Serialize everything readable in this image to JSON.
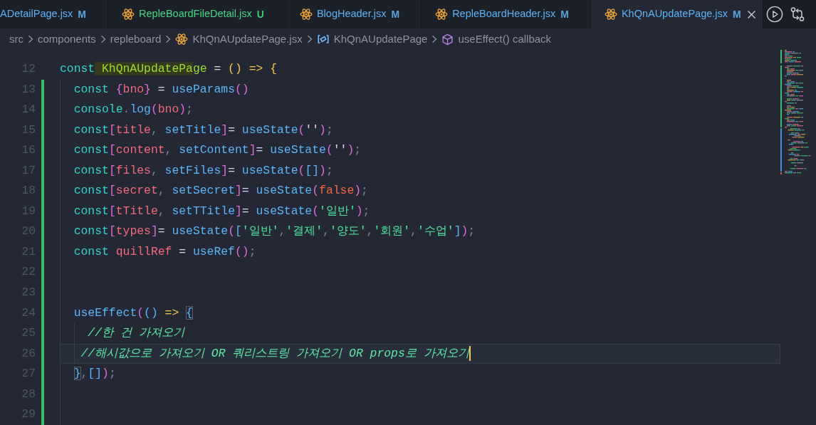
{
  "tabs": [
    {
      "label": "ADetailPage.jsx",
      "status": "M",
      "kind": "modified",
      "cut_off": true,
      "selected": false
    },
    {
      "label": "RepleBoardFileDetail.jsx",
      "status": "U",
      "kind": "untracked",
      "cut_off": false,
      "selected": false
    },
    {
      "label": "BlogHeader.jsx",
      "status": "M",
      "kind": "modified",
      "cut_off": false,
      "selected": false
    },
    {
      "label": "RepleBoardHeader.jsx",
      "status": "M",
      "kind": "modified",
      "cut_off": false,
      "selected": false
    },
    {
      "label": "KhQnAUpdatePage.jsx",
      "status": "M",
      "kind": "modified",
      "cut_off": false,
      "selected": true
    }
  ],
  "breadcrumb": [
    {
      "label": "src",
      "kind": "folder"
    },
    {
      "label": "components",
      "kind": "folder"
    },
    {
      "label": "repleboard",
      "kind": "folder"
    },
    {
      "label": "KhQnAUpdatePage.jsx",
      "kind": "file"
    },
    {
      "label": "KhQnAUpdatePage",
      "kind": "constant"
    },
    {
      "label": "useEffect() callback",
      "kind": "method"
    }
  ],
  "editor": {
    "lines": [
      {
        "number": "12",
        "added": false,
        "current": false,
        "tokens": [
          {
            "text": "const",
            "kind": "keyword"
          },
          {
            "text": " KhQnAUpdatePa",
            "kind": "definition_match"
          },
          {
            "text": "ge",
            "kind": "definition"
          },
          {
            "text": " = ",
            "kind": "operator"
          },
          {
            "text": "()",
            "kind": "bracket_1"
          },
          {
            "text": " => ",
            "kind": "arrow"
          },
          {
            "text": "{",
            "kind": "bracket_1"
          }
        ]
      },
      {
        "number": "13",
        "added": true,
        "current": false,
        "tokens": [
          {
            "text": "  const ",
            "kind": "keyword"
          },
          {
            "text": "{",
            "kind": "bracket_2"
          },
          {
            "text": "bno",
            "kind": "variable"
          },
          {
            "text": "}",
            "kind": "bracket_2"
          },
          {
            "text": " = ",
            "kind": "operator"
          },
          {
            "text": "useParams",
            "kind": "function"
          },
          {
            "text": "()",
            "kind": "bracket_2"
          }
        ]
      },
      {
        "number": "14",
        "added": true,
        "current": false,
        "tokens": [
          {
            "text": "  console",
            "kind": "keyword"
          },
          {
            "text": ".",
            "kind": "punctuation"
          },
          {
            "text": "log",
            "kind": "function"
          },
          {
            "text": "(",
            "kind": "bracket_2"
          },
          {
            "text": "bno",
            "kind": "variable"
          },
          {
            "text": ")",
            "kind": "bracket_2"
          },
          {
            "text": ";",
            "kind": "punctuation"
          }
        ]
      },
      {
        "number": "15",
        "added": true,
        "current": false,
        "tokens": [
          {
            "text": "  const",
            "kind": "keyword"
          },
          {
            "text": "[",
            "kind": "bracket_2"
          },
          {
            "text": "title",
            "kind": "variable"
          },
          {
            "text": ", ",
            "kind": "punctuation"
          },
          {
            "text": "setTitle",
            "kind": "function"
          },
          {
            "text": "]",
            "kind": "bracket_2"
          },
          {
            "text": "= ",
            "kind": "operator"
          },
          {
            "text": "useState",
            "kind": "function"
          },
          {
            "text": "(",
            "kind": "bracket_2"
          },
          {
            "text": "''",
            "kind": "quote"
          },
          {
            "text": ")",
            "kind": "bracket_2"
          },
          {
            "text": ";",
            "kind": "punctuation"
          }
        ]
      },
      {
        "number": "16",
        "added": true,
        "current": false,
        "tokens": [
          {
            "text": "  const",
            "kind": "keyword"
          },
          {
            "text": "[",
            "kind": "bracket_2"
          },
          {
            "text": "content",
            "kind": "variable"
          },
          {
            "text": ", ",
            "kind": "punctuation"
          },
          {
            "text": "setContent",
            "kind": "function"
          },
          {
            "text": "]",
            "kind": "bracket_2"
          },
          {
            "text": "= ",
            "kind": "operator"
          },
          {
            "text": "useState",
            "kind": "function"
          },
          {
            "text": "(",
            "kind": "bracket_2"
          },
          {
            "text": "''",
            "kind": "quote"
          },
          {
            "text": ")",
            "kind": "bracket_2"
          },
          {
            "text": ";",
            "kind": "punctuation"
          }
        ]
      },
      {
        "number": "17",
        "added": true,
        "current": false,
        "tokens": [
          {
            "text": "  const",
            "kind": "keyword"
          },
          {
            "text": "[",
            "kind": "bracket_2"
          },
          {
            "text": "files",
            "kind": "variable"
          },
          {
            "text": ", ",
            "kind": "punctuation"
          },
          {
            "text": "setFiles",
            "kind": "function"
          },
          {
            "text": "]",
            "kind": "bracket_2"
          },
          {
            "text": "= ",
            "kind": "operator"
          },
          {
            "text": "useState",
            "kind": "function"
          },
          {
            "text": "(",
            "kind": "bracket_2"
          },
          {
            "text": "[]",
            "kind": "bracket_3"
          },
          {
            "text": ")",
            "kind": "bracket_2"
          },
          {
            "text": ";",
            "kind": "punctuation"
          }
        ]
      },
      {
        "number": "18",
        "added": true,
        "current": false,
        "tokens": [
          {
            "text": "  const",
            "kind": "keyword"
          },
          {
            "text": "[",
            "kind": "bracket_2"
          },
          {
            "text": "secret",
            "kind": "variable"
          },
          {
            "text": ", ",
            "kind": "punctuation"
          },
          {
            "text": "setSecret",
            "kind": "function"
          },
          {
            "text": "]",
            "kind": "bracket_2"
          },
          {
            "text": "= ",
            "kind": "operator"
          },
          {
            "text": "useState",
            "kind": "function"
          },
          {
            "text": "(",
            "kind": "bracket_2"
          },
          {
            "text": "false",
            "kind": "boolean"
          },
          {
            "text": ")",
            "kind": "bracket_2"
          },
          {
            "text": ";",
            "kind": "punctuation"
          }
        ]
      },
      {
        "number": "19",
        "added": true,
        "current": false,
        "tokens": [
          {
            "text": "  const",
            "kind": "keyword"
          },
          {
            "text": "[",
            "kind": "bracket_2"
          },
          {
            "text": "tTitle",
            "kind": "variable"
          },
          {
            "text": ", ",
            "kind": "punctuation"
          },
          {
            "text": "setTTitle",
            "kind": "function"
          },
          {
            "text": "]",
            "kind": "bracket_2"
          },
          {
            "text": "= ",
            "kind": "operator"
          },
          {
            "text": "useState",
            "kind": "function"
          },
          {
            "text": "(",
            "kind": "bracket_2"
          },
          {
            "text": "'일반'",
            "kind": "string"
          },
          {
            "text": ")",
            "kind": "bracket_2"
          },
          {
            "text": ";",
            "kind": "punctuation"
          }
        ]
      },
      {
        "number": "20",
        "added": true,
        "current": false,
        "tokens": [
          {
            "text": "  const",
            "kind": "keyword"
          },
          {
            "text": "[",
            "kind": "bracket_2"
          },
          {
            "text": "types",
            "kind": "variable"
          },
          {
            "text": "]",
            "kind": "bracket_2"
          },
          {
            "text": "= ",
            "kind": "operator"
          },
          {
            "text": "useState",
            "kind": "function"
          },
          {
            "text": "(",
            "kind": "bracket_2"
          },
          {
            "text": "[",
            "kind": "bracket_3"
          },
          {
            "text": "'일반'",
            "kind": "string"
          },
          {
            "text": ",",
            "kind": "punctuation"
          },
          {
            "text": "'결제'",
            "kind": "string"
          },
          {
            "text": ",",
            "kind": "punctuation"
          },
          {
            "text": "'양도'",
            "kind": "string"
          },
          {
            "text": ",",
            "kind": "punctuation"
          },
          {
            "text": "'회원'",
            "kind": "string"
          },
          {
            "text": ",",
            "kind": "punctuation"
          },
          {
            "text": "'수업'",
            "kind": "string"
          },
          {
            "text": "]",
            "kind": "bracket_3"
          },
          {
            "text": ")",
            "kind": "bracket_2"
          },
          {
            "text": ";",
            "kind": "punctuation"
          }
        ]
      },
      {
        "number": "21",
        "added": true,
        "current": false,
        "tokens": [
          {
            "text": "  const ",
            "kind": "keyword"
          },
          {
            "text": "quillRef",
            "kind": "variable"
          },
          {
            "text": " = ",
            "kind": "operator"
          },
          {
            "text": "useRef",
            "kind": "function"
          },
          {
            "text": "()",
            "kind": "bracket_2"
          },
          {
            "text": ";",
            "kind": "punctuation"
          }
        ]
      },
      {
        "number": "22",
        "added": true,
        "current": false
      },
      {
        "number": "23",
        "added": true,
        "current": false
      },
      {
        "number": "24",
        "added": true,
        "current": false,
        "tokens": [
          {
            "text": "  useEffect",
            "kind": "function"
          },
          {
            "text": "(",
            "kind": "bracket_2"
          },
          {
            "text": "()",
            "kind": "bracket_3"
          },
          {
            "text": " => ",
            "kind": "arrow"
          },
          {
            "text": "{",
            "kind": "bracket_3_match"
          }
        ]
      },
      {
        "number": "25",
        "added": true,
        "current": false,
        "tokens": [
          {
            "text": "    //한 건 가져오기",
            "kind": "comment"
          }
        ]
      },
      {
        "number": "26",
        "added": true,
        "current": true,
        "tokens": [
          {
            "text": "   //해시값으로 가져오기 OR 쿼리스트링 가져오기 OR props로 가져오기",
            "kind": "comment"
          }
        ]
      },
      {
        "number": "27",
        "added": true,
        "current": false,
        "tokens": [
          {
            "text": "  }",
            "kind": "bracket_3_match"
          },
          {
            "text": ",",
            "kind": "punctuation"
          },
          {
            "text": "[]",
            "kind": "bracket_3"
          },
          {
            "text": ")",
            "kind": "bracket_2"
          },
          {
            "text": ";",
            "kind": "punctuation"
          }
        ]
      },
      {
        "number": "28",
        "added": true,
        "current": false
      },
      {
        "number": "29",
        "added": true,
        "current": false
      }
    ]
  }
}
